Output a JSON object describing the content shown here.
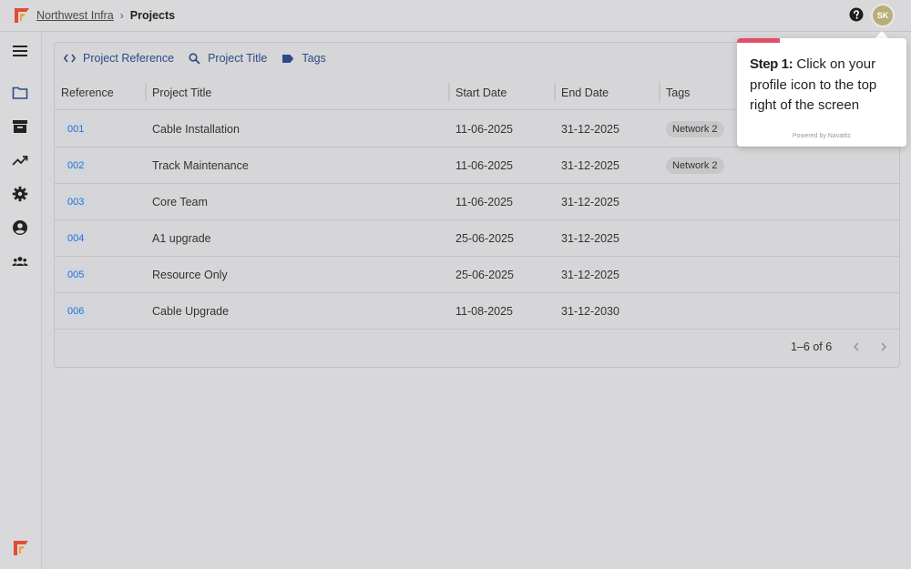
{
  "header": {
    "breadcrumb_root": "Northwest Infra",
    "breadcrumb_sep": "›",
    "breadcrumb_current": "Projects",
    "avatar_initials": "SK"
  },
  "sidebar": {
    "items": [
      {
        "icon": "menu-icon"
      },
      {
        "icon": "folder-icon"
      },
      {
        "icon": "archive-icon"
      },
      {
        "icon": "trending-up-icon"
      },
      {
        "icon": "gear-icon"
      },
      {
        "icon": "account-circle-icon"
      },
      {
        "icon": "group-icon"
      }
    ]
  },
  "filters": {
    "reference": "Project Reference",
    "title": "Project Title",
    "tags": "Tags"
  },
  "table": {
    "columns": [
      "Reference",
      "Project Title",
      "Start Date",
      "End Date",
      "Tags"
    ],
    "rows": [
      {
        "ref": "001",
        "title": "Cable Installation",
        "start": "11-06-2025",
        "end": "31-12-2025",
        "tag": "Network 2"
      },
      {
        "ref": "002",
        "title": "Track Maintenance",
        "start": "11-06-2025",
        "end": "31-12-2025",
        "tag": "Network 2"
      },
      {
        "ref": "003",
        "title": "Core Team",
        "start": "11-06-2025",
        "end": "31-12-2025",
        "tag": ""
      },
      {
        "ref": "004",
        "title": "A1 upgrade",
        "start": "25-06-2025",
        "end": "31-12-2025",
        "tag": ""
      },
      {
        "ref": "005",
        "title": "Resource Only",
        "start": "25-06-2025",
        "end": "31-12-2025",
        "tag": ""
      },
      {
        "ref": "006",
        "title": "Cable Upgrade",
        "start": "11-08-2025",
        "end": "31-12-2030",
        "tag": ""
      }
    ]
  },
  "pagination": {
    "range": "1–6 of 6"
  },
  "tooltip": {
    "step": "Step 1:",
    "text": " Click on your profile icon to the top right of the screen",
    "powered": "Powered by Navattic",
    "progress": 0.25
  },
  "colors": {
    "accent": "#2d4a86",
    "link": "#2e6fc9",
    "progress": "#e0506a",
    "logo_red": "#e14b3b",
    "logo_orange": "#f2a23a"
  }
}
